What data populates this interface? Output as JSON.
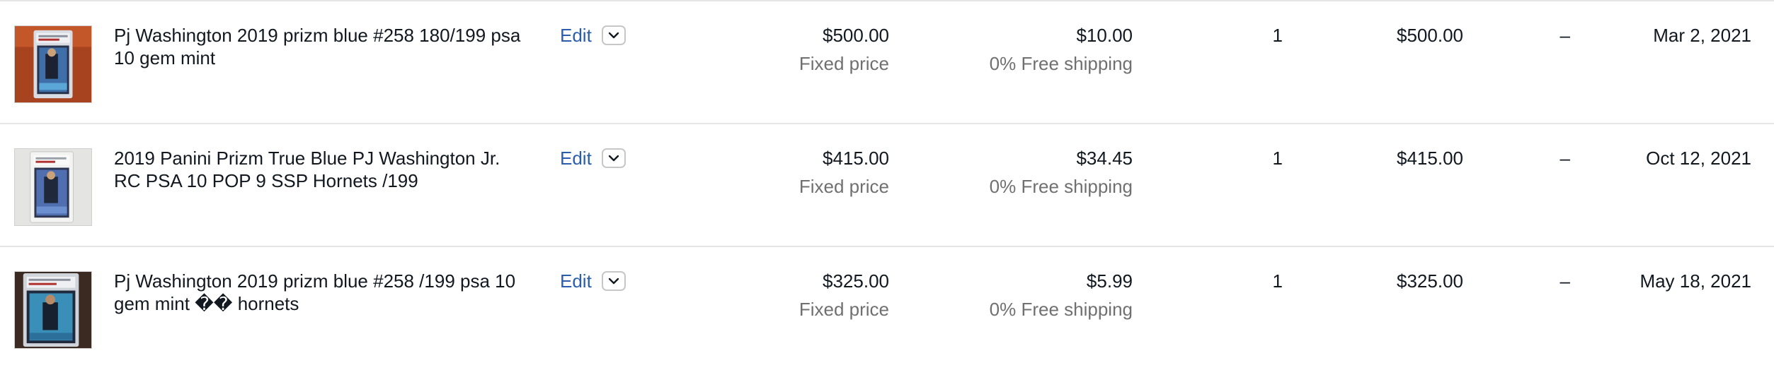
{
  "colors": {
    "link": "#2a5db0",
    "text": "#111820",
    "muted": "#707070",
    "divider": "#e5e5e5"
  },
  "rows": [
    {
      "thumbnail_icon": "graded-card-photo-icon",
      "title": "Pj Washington 2019 prizm blue #258 180/199 psa 10 gem mint",
      "edit_label": "Edit",
      "dropdown_icon": "chevron-down-icon",
      "price": "$500.00",
      "price_format": "Fixed price",
      "shipping": "$10.00",
      "shipping_note": "0% Free shipping",
      "quantity": "1",
      "total": "$500.00",
      "dash": "–",
      "date": "Mar 2, 2021"
    },
    {
      "thumbnail_icon": "graded-card-photo-icon",
      "title": "2019 Panini Prizm True Blue PJ Washington Jr. RC PSA 10 POP 9 SSP Hornets /199",
      "edit_label": "Edit",
      "dropdown_icon": "chevron-down-icon",
      "price": "$415.00",
      "price_format": "Fixed price",
      "shipping": "$34.45",
      "shipping_note": "0% Free shipping",
      "quantity": "1",
      "total": "$415.00",
      "dash": "–",
      "date": "Oct 12, 2021"
    },
    {
      "thumbnail_icon": "graded-card-photo-icon",
      "title": "Pj Washington 2019 prizm blue #258 /199 psa 10 gem mint �� hornets",
      "edit_label": "Edit",
      "dropdown_icon": "chevron-down-icon",
      "price": "$325.00",
      "price_format": "Fixed price",
      "shipping": "$5.99",
      "shipping_note": "0% Free shipping",
      "quantity": "1",
      "total": "$325.00",
      "dash": "–",
      "date": "May 18, 2021"
    }
  ]
}
